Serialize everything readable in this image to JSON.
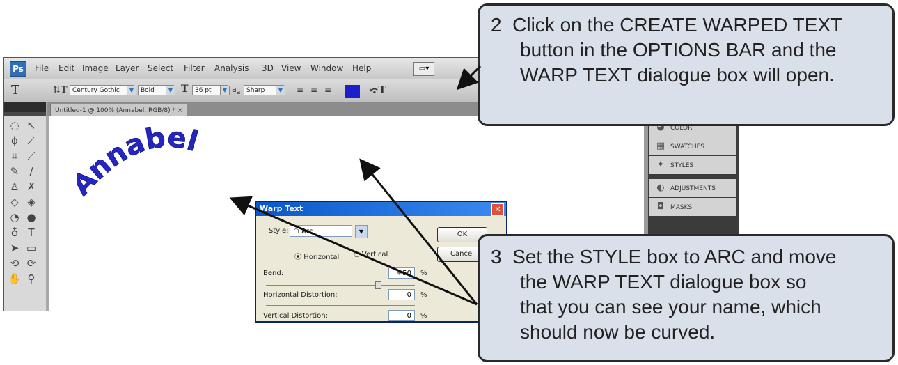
{
  "app": {
    "logo": "Ps",
    "menu": [
      "File",
      "Edit",
      "Image",
      "Layer",
      "Select",
      "Filter",
      "Analysis",
      "3D",
      "View",
      "Window",
      "Help"
    ]
  },
  "options_bar": {
    "font_family": "Century Gothic",
    "font_style": "Bold",
    "font_size": "36 pt",
    "antialias": "Sharp",
    "text_color": "#1e1ec8"
  },
  "document": {
    "tab_title": "Untitled-1 @ 100% (Annabel, RGB/8) *",
    "text": "Annabel",
    "text_color": "#2525c0"
  },
  "panels": [
    "COLOR",
    "SWATCHES",
    "STYLES",
    "ADJUSTMENTS",
    "MASKS"
  ],
  "dialog": {
    "title": "Warp Text",
    "style_label": "Style:",
    "style_value": "Arc",
    "horizontal_label": "Horizontal",
    "vertical_label": "Vertical",
    "orientation_selected": "Horizontal",
    "bend_label": "Bend:",
    "bend_value": "+50",
    "bend_percent": 50,
    "hdist_label": "Horizontal Distortion:",
    "hdist_value": "0",
    "vdist_label": "Vertical Distortion:",
    "vdist_value": "0",
    "percent": "%",
    "ok_label": "OK",
    "cancel_label": "Cancel"
  },
  "callouts": {
    "step2": {
      "number": "2",
      "line1": "Click on the CREATE WARPED TEXT",
      "line2": "button in the OPTIONS BAR and the",
      "line3": "WARP TEXT dialogue box will open."
    },
    "step3": {
      "number": "3",
      "line1": "Set the STYLE box to ARC and move",
      "line2": "the WARP TEXT dialogue box so",
      "line3": "that you can see your name, which",
      "line4": "should now be curved."
    }
  }
}
